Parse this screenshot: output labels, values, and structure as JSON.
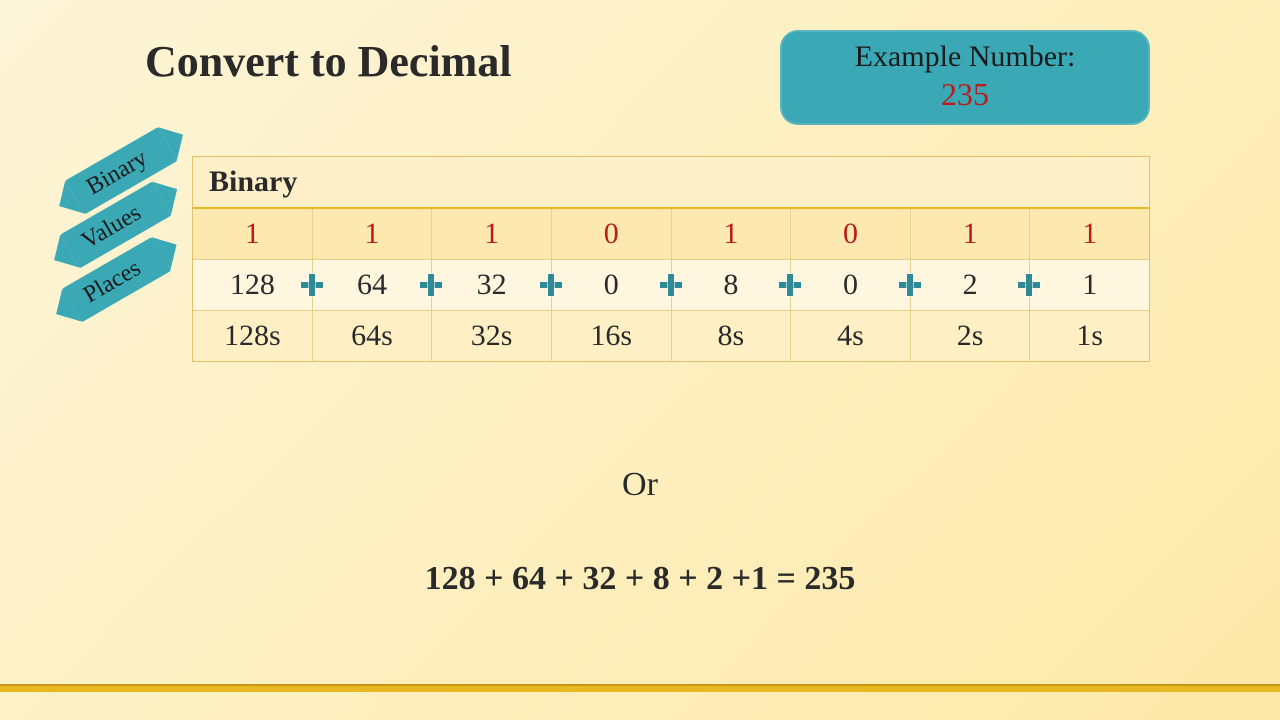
{
  "title": "Convert to Decimal",
  "example": {
    "label": "Example Number:",
    "value": "235"
  },
  "labels": {
    "binary": "Binary",
    "values": "Values",
    "places": "Places"
  },
  "table": {
    "header": "Binary",
    "binary": [
      "1",
      "1",
      "1",
      "0",
      "1",
      "0",
      "1",
      "1"
    ],
    "values": [
      "128",
      "64",
      "32",
      "0",
      "8",
      "0",
      "2",
      "1"
    ],
    "places": [
      "128s",
      "64s",
      "32s",
      "16s",
      "8s",
      "4s",
      "2s",
      "1s"
    ]
  },
  "or_text": "Or",
  "sum_text": "128 + 64 + 32 + 8 + 2 +1 = 235",
  "chart_data": {
    "type": "table",
    "title": "Convert to Decimal",
    "columns": [
      "128s",
      "64s",
      "32s",
      "16s",
      "8s",
      "4s",
      "2s",
      "1s"
    ],
    "rows": [
      {
        "name": "Binary",
        "values": [
          1,
          1,
          1,
          0,
          1,
          0,
          1,
          1
        ]
      },
      {
        "name": "Values",
        "values": [
          128,
          64,
          32,
          0,
          8,
          0,
          2,
          1
        ]
      }
    ],
    "sum": 235
  }
}
